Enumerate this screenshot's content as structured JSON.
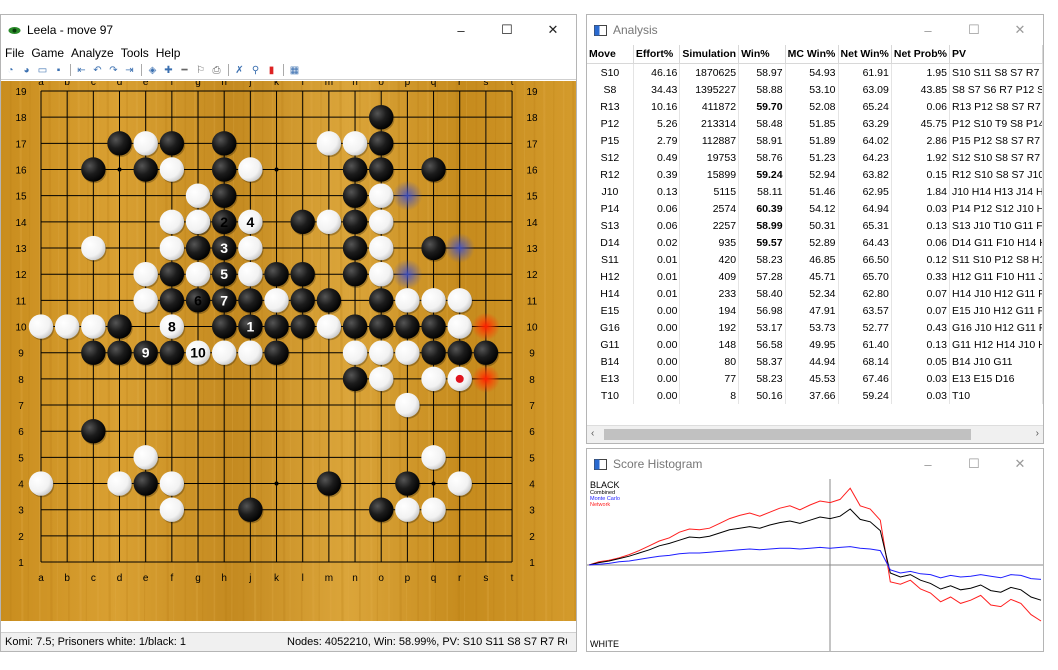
{
  "leela": {
    "title": "Leela - move 97",
    "menu": [
      "File",
      "Game",
      "Analyze",
      "Tools",
      "Help"
    ],
    "win_controls": [
      "–",
      "☐",
      "✕"
    ],
    "toolbar_icons": [
      "new-game-icon",
      "new-game-alt-icon",
      "open-icon",
      "save-icon",
      "back-icon",
      "undo-icon",
      "redo-icon",
      "forward-icon",
      "analyze-icon",
      "plus-icon",
      "minus-icon",
      "pass-icon",
      "print-icon",
      "cancel-icon",
      "search-icon",
      "stop-icon",
      "score-icon"
    ],
    "status_left": "Komi: 7.5; Prisoners white: 1/black: 1",
    "status_right": "Nodes: 4052210, Win: 58.99%, PV: S10 S11 S8 S7 R7 R6 O7 N7 M",
    "board": {
      "columns": [
        "a",
        "b",
        "c",
        "d",
        "e",
        "f",
        "g",
        "h",
        "j",
        "k",
        "l",
        "m",
        "n",
        "o",
        "p",
        "q",
        "r",
        "s",
        "t"
      ],
      "rows": [
        "19",
        "18",
        "17",
        "16",
        "15",
        "14",
        "13",
        "12",
        "11",
        "10",
        "9",
        "8",
        "7",
        "6",
        "5",
        "4",
        "3",
        "2",
        "1"
      ],
      "black": [
        "o18",
        "d17",
        "f17",
        "h17",
        "o17",
        "c16",
        "e16",
        "h16",
        "n16",
        "o16",
        "q16",
        "h15",
        "n15",
        "h14",
        "g14",
        "l14",
        "n14",
        "g13",
        "h13",
        "n13",
        "q13",
        "f12",
        "h12",
        "k12",
        "l12",
        "n12",
        "f11",
        "g11",
        "h11",
        "j11",
        "l11",
        "m11",
        "o11",
        "d10",
        "h10",
        "j10",
        "k10",
        "l10",
        "n10",
        "o10",
        "p10",
        "q10",
        "c9",
        "d9",
        "e9",
        "f9",
        "k9",
        "q9",
        "r9",
        "s9",
        "n8",
        "c6",
        "e4",
        "m4",
        "p4",
        "j3",
        "o3"
      ],
      "white": [
        "e17",
        "m17",
        "n17",
        "f16",
        "j16",
        "g15",
        "o15",
        "f14",
        "g14x",
        "j14",
        "m14",
        "o14",
        "c13",
        "f13",
        "j13",
        "o13",
        "e12",
        "g12",
        "j12",
        "o12",
        "e11",
        "k11",
        "p11",
        "q11",
        "r11",
        "a10",
        "b10",
        "c10",
        "f10",
        "m10",
        "r10",
        "j9",
        "n9",
        "o9",
        "p9",
        "o8",
        "q8",
        "r8",
        "p7",
        "e5",
        "q5",
        "a4",
        "d4",
        "f4",
        "r4",
        "f3",
        "p3",
        "q3",
        "h9x",
        "g9"
      ],
      "labels": [
        {
          "point": "h14",
          "text": "2",
          "color": "white"
        },
        {
          "point": "j14",
          "text": "4",
          "color": "white"
        },
        {
          "point": "h13",
          "text": "3",
          "color": "black"
        },
        {
          "point": "h12",
          "text": "5",
          "color": "black"
        },
        {
          "point": "g11",
          "text": "6",
          "color": "white"
        },
        {
          "point": "h11",
          "text": "7",
          "color": "black"
        },
        {
          "point": "j10",
          "text": "1",
          "color": "black"
        },
        {
          "point": "f10",
          "text": "8",
          "color": "white"
        },
        {
          "point": "e9",
          "text": "9",
          "color": "black"
        },
        {
          "point": "g9",
          "text": "10",
          "color": "white"
        }
      ],
      "hints": [
        {
          "point": "p15",
          "color": "#3c50d2"
        },
        {
          "point": "r13",
          "color": "#3c50d2"
        },
        {
          "point": "p12",
          "color": "#3c50d2"
        },
        {
          "point": "s10",
          "color": "#ff1e00"
        },
        {
          "point": "s8",
          "color": "#ff3c00"
        }
      ],
      "last_move": "r8",
      "last_move_color": "#e0141e"
    }
  },
  "analysis": {
    "title": "Analysis",
    "win_controls": [
      "–",
      "☐",
      "✕"
    ],
    "columns": [
      "Move",
      "Effort%",
      "Simulation",
      "Win%",
      "MC Win%",
      "Net Win%",
      "Net Prob%",
      "PV"
    ],
    "rows": [
      [
        "S10",
        "46.16",
        "1870625",
        "58.97",
        "54.93",
        "61.91",
        "1.95",
        "S10 S11 S8 S7 R7 R6"
      ],
      [
        "S8",
        "34.43",
        "1395227",
        "58.88",
        "53.10",
        "63.09",
        "43.85",
        "S8 S7 S6 R7 P12 S10"
      ],
      [
        "R13",
        "10.16",
        "411872",
        "59.70",
        "52.08",
        "65.24",
        "0.06",
        "R13 P12 S8 S7 R7 R6"
      ],
      [
        "P12",
        "5.26",
        "213314",
        "58.48",
        "51.85",
        "63.29",
        "45.75",
        "P12 S10 T9 S8 P14 T"
      ],
      [
        "P15",
        "2.79",
        "112887",
        "58.91",
        "51.89",
        "64.02",
        "2.86",
        "P15 P12 S8 S7 R7 R6"
      ],
      [
        "S12",
        "0.49",
        "19753",
        "58.76",
        "51.23",
        "64.23",
        "1.92",
        "S12 S10 S8 S7 R7 T8"
      ],
      [
        "R12",
        "0.39",
        "15899",
        "59.24",
        "52.94",
        "63.82",
        "0.15",
        "R12 S10 S8 S7 J10 H"
      ],
      [
        "J10",
        "0.13",
        "5115",
        "58.11",
        "51.46",
        "62.95",
        "1.84",
        "J10 H14 H13 J14 H12"
      ],
      [
        "P14",
        "0.06",
        "2574",
        "60.39",
        "54.12",
        "64.94",
        "0.03",
        "P14 P12 S12 J10 H12"
      ],
      [
        "S13",
        "0.06",
        "2257",
        "58.99",
        "50.31",
        "65.31",
        "0.13",
        "S13 J10 T10 G11 F10"
      ],
      [
        "D14",
        "0.02",
        "935",
        "59.57",
        "52.89",
        "64.43",
        "0.06",
        "D14 G11 F10 H14 H1"
      ],
      [
        "S11",
        "0.01",
        "420",
        "58.23",
        "46.85",
        "66.50",
        "0.12",
        "S11 S10 P12 S8 H12"
      ],
      [
        "H12",
        "0.01",
        "409",
        "57.28",
        "45.71",
        "65.70",
        "0.33",
        "H12 G11 F10 H11 J1"
      ],
      [
        "H14",
        "0.01",
        "233",
        "58.40",
        "52.34",
        "62.80",
        "0.07",
        "H14 J10 H12 G11 F1"
      ],
      [
        "E15",
        "0.00",
        "194",
        "56.98",
        "47.91",
        "63.57",
        "0.07",
        "E15 J10 H12 G11 F1"
      ],
      [
        "G16",
        "0.00",
        "192",
        "53.17",
        "53.73",
        "52.77",
        "0.43",
        "G16 J10 H12 G11 F1"
      ],
      [
        "G11",
        "0.00",
        "148",
        "56.58",
        "49.95",
        "61.40",
        "0.13",
        "G11 H12 H14 J10 H"
      ],
      [
        "B14",
        "0.00",
        "80",
        "58.37",
        "44.94",
        "68.14",
        "0.05",
        "B14 J10 G11"
      ],
      [
        "E13",
        "0.00",
        "77",
        "58.23",
        "45.53",
        "67.46",
        "0.03",
        "E13 E15 D16"
      ],
      [
        "T10",
        "0.00",
        "8",
        "50.16",
        "37.66",
        "59.24",
        "0.03",
        "T10"
      ]
    ],
    "bold_win": [
      "R13",
      "R12",
      "P14",
      "S13",
      "D14"
    ]
  },
  "histogram": {
    "title": "Score Histogram",
    "win_controls": [
      "–",
      "☐",
      "✕"
    ],
    "top_label": "BLACK",
    "bottom_label": "WHITE",
    "legend": [
      {
        "name": "Combined",
        "color": "#000000"
      },
      {
        "name": "Monte Carlo",
        "color": "#1e1eff"
      },
      {
        "name": "Network",
        "color": "#ff1e1e"
      }
    ],
    "chart_data": {
      "type": "line",
      "series": [
        {
          "name": "Network",
          "color": "#ff1e1e",
          "values": [
            0.0,
            0.04,
            0.06,
            0.09,
            0.13,
            0.18,
            0.24,
            0.3,
            0.34,
            0.41,
            0.45,
            0.44,
            0.46,
            0.52,
            0.58,
            0.62,
            0.65,
            0.61,
            0.66,
            0.71,
            0.74,
            0.69,
            0.75,
            0.8,
            0.78,
            0.82,
            0.96,
            0.74,
            0.7,
            0.56,
            -0.21,
            -0.24,
            -0.19,
            -0.3,
            -0.35,
            -0.46,
            -0.4,
            -0.48,
            -0.44,
            -0.38,
            -0.5,
            -0.52,
            -0.43,
            -0.48,
            -0.62,
            -0.7
          ]
        },
        {
          "name": "Combined",
          "color": "#000000",
          "values": [
            0.0,
            0.03,
            0.05,
            0.08,
            0.11,
            0.15,
            0.19,
            0.24,
            0.27,
            0.31,
            0.35,
            0.34,
            0.36,
            0.4,
            0.44,
            0.46,
            0.48,
            0.46,
            0.5,
            0.53,
            0.55,
            0.52,
            0.56,
            0.6,
            0.58,
            0.61,
            0.7,
            0.57,
            0.54,
            0.43,
            -0.1,
            -0.15,
            -0.12,
            -0.19,
            -0.23,
            -0.3,
            -0.26,
            -0.31,
            -0.29,
            -0.25,
            -0.32,
            -0.34,
            -0.28,
            -0.31,
            -0.4,
            -0.44
          ]
        },
        {
          "name": "Monte Carlo",
          "color": "#1e1eff",
          "values": [
            0.0,
            0.01,
            0.02,
            0.04,
            0.05,
            0.07,
            0.09,
            0.11,
            0.12,
            0.14,
            0.15,
            0.15,
            0.16,
            0.17,
            0.18,
            0.19,
            0.2,
            0.19,
            0.2,
            0.21,
            0.21,
            0.2,
            0.21,
            0.22,
            0.21,
            0.22,
            0.23,
            0.21,
            0.2,
            0.18,
            -0.06,
            -0.1,
            -0.08,
            -0.11,
            -0.12,
            -0.16,
            -0.13,
            -0.15,
            -0.14,
            -0.12,
            -0.14,
            -0.16,
            -0.12,
            -0.13,
            -0.17,
            -0.18
          ]
        }
      ],
      "ylim": [
        -1,
        1
      ],
      "grid": false
    }
  }
}
